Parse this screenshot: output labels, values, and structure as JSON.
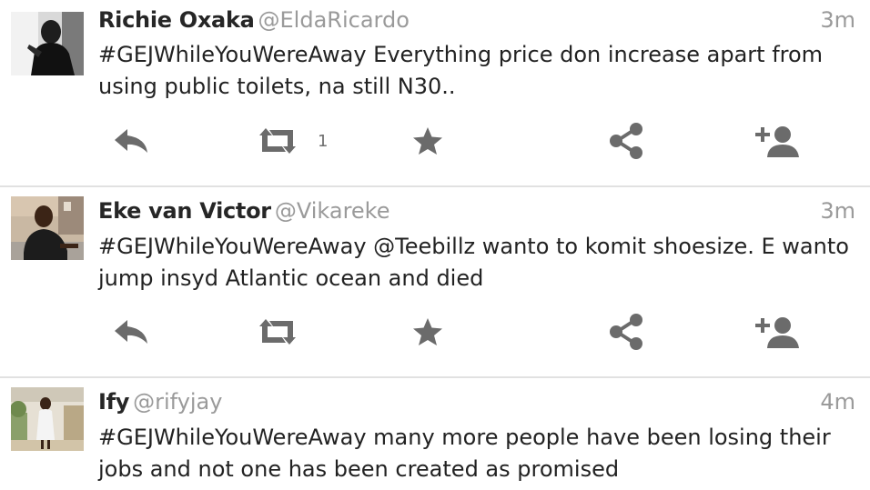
{
  "tweets": [
    {
      "name": "Richie Oxaka",
      "handle": "@EldaRicardo",
      "time": "3m",
      "text": "#GEJWhileYouWereAway Everything price don increase apart from using public toilets, na still N30..",
      "retweet_count": "1"
    },
    {
      "name": "Eke van Victor",
      "handle": "@Vikareke",
      "time": "3m",
      "text": "#GEJWhileYouWereAway @Teebillz wanto to komit shoesize. E wanto jump insyd Atlantic ocean and died",
      "retweet_count": ""
    },
    {
      "name": "Ify",
      "handle": "@rifyjay",
      "time": "4m",
      "text": "#GEJWhileYouWereAway many more people have been losing their jobs and not one has been created as promised"
    }
  ],
  "icons": {
    "reply": "reply-icon",
    "retweet": "retweet-icon",
    "favorite": "star-icon",
    "share": "share-icon",
    "follow": "follow-icon"
  },
  "colors": {
    "icon": "#6b6b6b",
    "muted": "#9a9a9a",
    "divider": "#e1e1e1",
    "text": "#222222"
  }
}
